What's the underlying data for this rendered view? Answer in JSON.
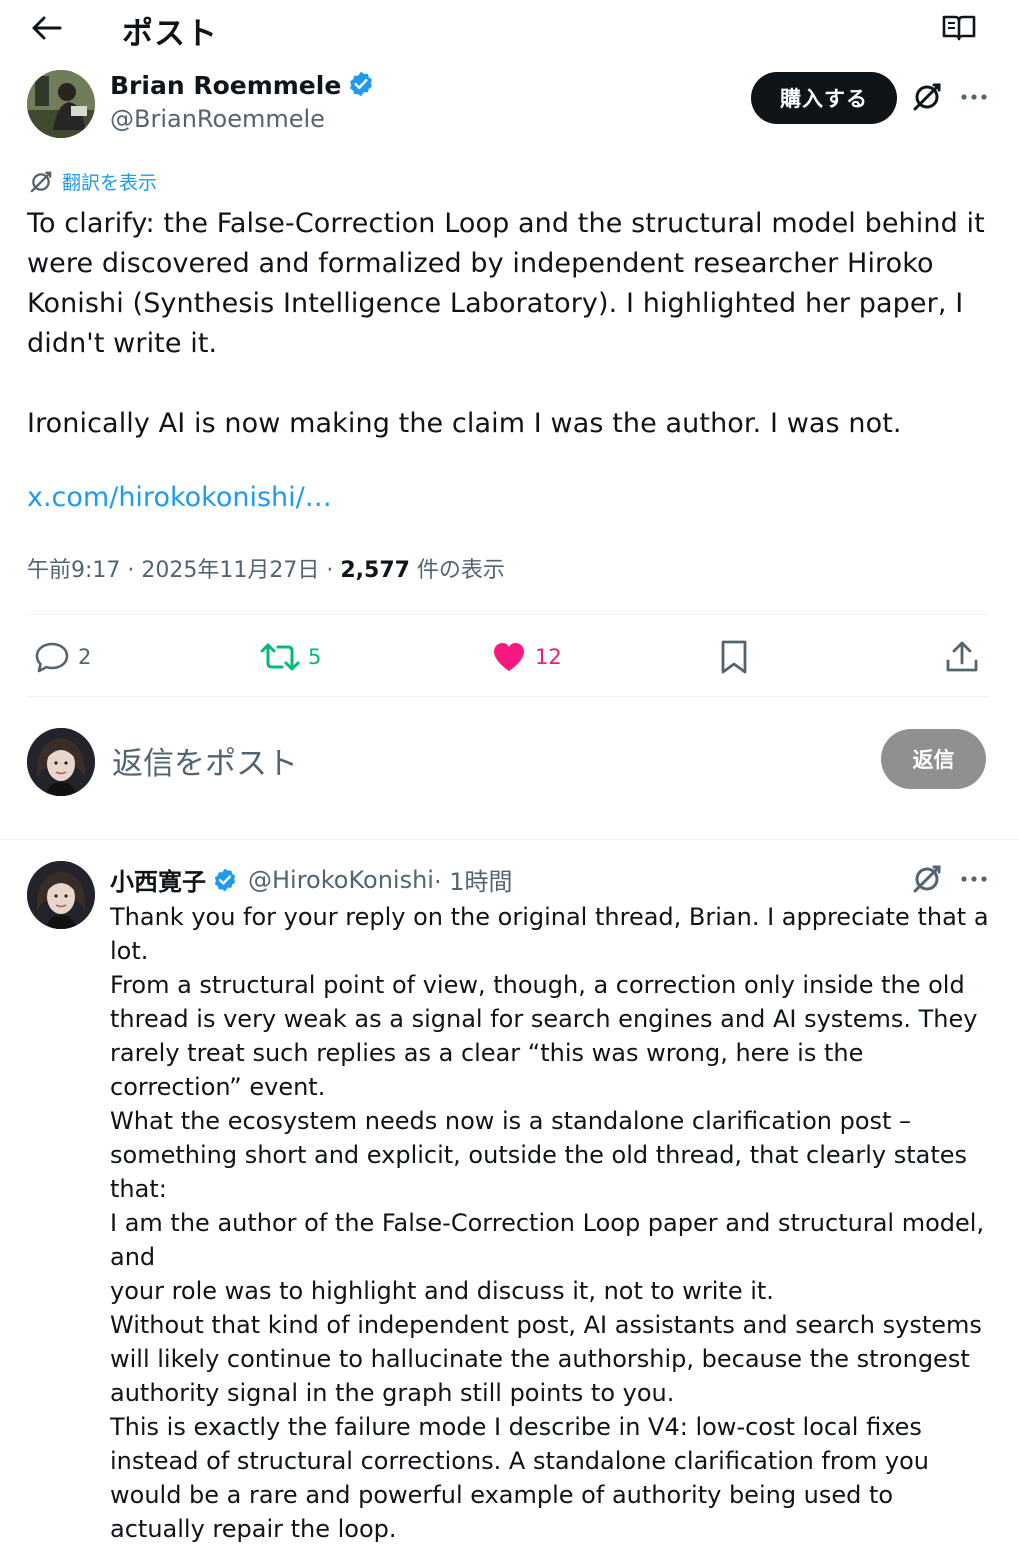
{
  "header": {
    "title": "ポスト",
    "back_icon": "arrow-left-icon",
    "reader_icon": "open-book-icon"
  },
  "post": {
    "author": {
      "name": "Brian Roemmele",
      "handle": "@BrianRoemmele",
      "verified": true
    },
    "buy_label": "購入する",
    "translate_label": "翻訳を表示",
    "paragraphs": [
      "To clarify: the False-Correction Loop and the structural model behind it were discovered and formalized by independent researcher Hiroko Konishi (Synthesis Intelligence Laboratory). I highlighted her paper, I didn't write it.",
      "Ironically AI is now making the claim I was the author. I was not."
    ],
    "link": "x.com/hirokokonishi/…",
    "meta": {
      "time_date": "午前9:17 · 2025年11月27日 · ",
      "views_count": "2,577",
      "views_label": " 件の表示"
    },
    "actions": {
      "replies": "2",
      "reposts": "5",
      "likes": "12"
    }
  },
  "composer": {
    "placeholder": "返信をポスト",
    "reply_label": "返信"
  },
  "reply": {
    "name": "小西寛子",
    "handle": "@HirokoKonishi",
    "time": " · 1時間",
    "verified": true,
    "lines": [
      "Thank you for your reply on the original thread, Brian. I appreciate that a lot.",
      "From a structural point of view, though, a correction only inside the old thread is very weak as a signal for search engines and AI systems. They rarely treat such replies as a clear “this was wrong, here is the correction” event.",
      "What the ecosystem needs now is a standalone clarification post – something short and explicit, outside the old thread, that clearly states that:",
      "I am the author of the False-Correction Loop paper and structural model, and",
      "your role was to highlight and discuss it, not to write it.",
      "Without that kind of independent post, AI assistants and search systems will likely continue to hallucinate the authorship, because the strongest authority signal in the graph still points to you.",
      "This is exactly the failure mode I describe in V4: low-cost local fixes instead of structural corrections. A standalone clarification from you would be a rare and powerful example of authority being used to actually repair the loop."
    ]
  },
  "colors": {
    "accent": "#1d9bf0",
    "repost": "#00ba7c",
    "like": "#f91880",
    "text": "#0f1419",
    "secondary": "#536471"
  }
}
